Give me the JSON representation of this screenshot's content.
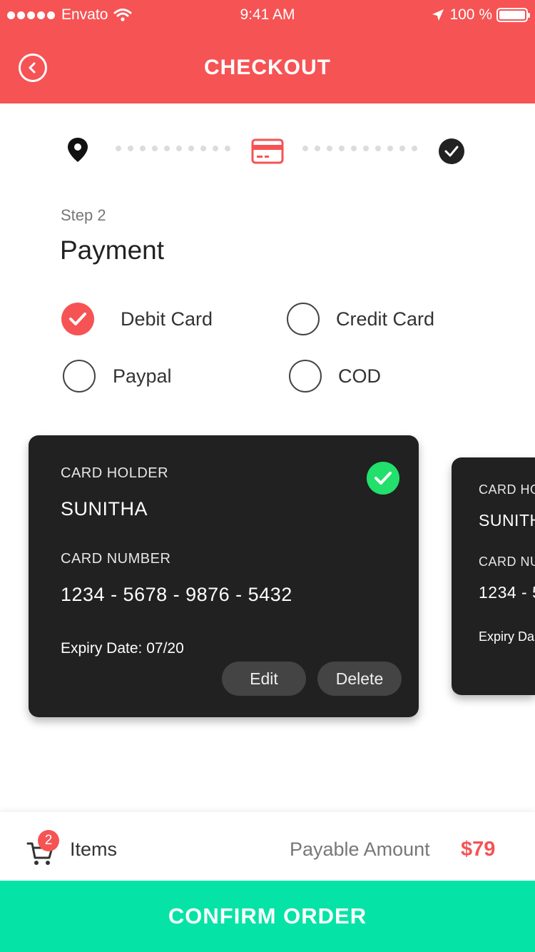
{
  "status_bar": {
    "carrier": "Envato",
    "time": "9:41 AM",
    "battery": "100 %"
  },
  "header": {
    "title": "CHECKOUT",
    "back_icon": "back-arrow-icon"
  },
  "stepper": {
    "steps": [
      {
        "icon": "location-pin-icon",
        "state": "done"
      },
      {
        "icon": "credit-card-icon",
        "state": "active"
      },
      {
        "icon": "check-icon",
        "state": "pending"
      }
    ]
  },
  "step": {
    "label": "Step 2",
    "title": "Payment"
  },
  "payment_options": [
    {
      "label": "Debit Card",
      "selected": true
    },
    {
      "label": "Credit Card",
      "selected": false
    },
    {
      "label": "Paypal",
      "selected": false
    },
    {
      "label": "COD",
      "selected": false
    }
  ],
  "cards": [
    {
      "holder_label": "CARD HOLDER",
      "holder": "SUNITHA",
      "number_label": "CARD NUMBER",
      "number": "1234 - 5678 - 9876 - 5432",
      "expiry": "Expiry Date: 07/20",
      "edit": "Edit",
      "delete": "Delete",
      "selected": true
    },
    {
      "holder_label": "CARD HO",
      "holder": "SUNITH",
      "number_label": "CARD NU",
      "number": "1234 - 5",
      "expiry": "Expiry Da"
    }
  ],
  "footer": {
    "cart_count": "2",
    "items_label": "Items",
    "payable_label": "Payable Amount",
    "amount": "$79"
  },
  "confirm": {
    "label": "CONFIRM ORDER"
  },
  "colors": {
    "brand": "#f65354",
    "confirm": "#06e3a6",
    "verified": "#22e06b",
    "card": "#212121"
  }
}
